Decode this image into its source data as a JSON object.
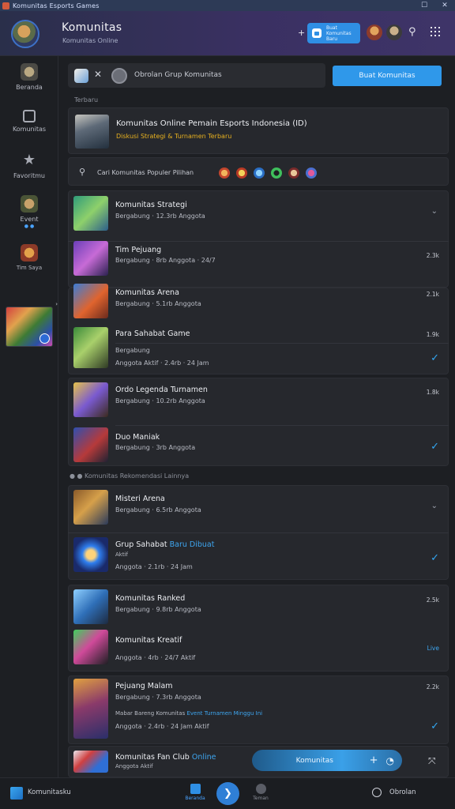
{
  "titlebar": {
    "title": "Komunitas Esports Games",
    "restore": "☐",
    "close": "✕"
  },
  "header": {
    "title": "Komunitas",
    "subtitle": "Komunitas Online",
    "plus": "+",
    "cta_label": "Buat Komunitas Baru",
    "search_icon": "⚲",
    "colors": {
      "accent": "#2f8fe4",
      "bg_start": "#2a2f4a",
      "bg_end": "#3e3468"
    }
  },
  "sidebar": {
    "items": [
      {
        "label": "Beranda"
      },
      {
        "label": "Komunitas"
      },
      {
        "label": "Favoritmu"
      },
      {
        "label": "Event",
        "sub": "● ●"
      },
      {
        "label": "Tim Saya"
      }
    ],
    "thumb_tag": "›"
  },
  "topbar": {
    "close_glyph": "✕",
    "text": "Obrolan Grup Komunitas",
    "primary_button": "Buat Komunitas"
  },
  "section_1": {
    "label": "Terbaru"
  },
  "feature": {
    "title": "Komunitas Online Pemain Esports Indonesia (ID)",
    "subtitle": "Diskusi Strategi & Turnamen Terbaru"
  },
  "filter": {
    "search_glyph": "⚲",
    "text": "Cari  Komunitas Populer  Pilihan"
  },
  "rows": [
    {
      "title": "Komunitas Strategi",
      "sub": "Bergabung · 12.3rb Anggota",
      "meta": "",
      "trailing": "chevron"
    },
    {
      "title": "Tim Pejuang",
      "sub": "Bergabung · 8rb Anggota · 24/7",
      "meta": "2.3k",
      "trailing": "none"
    },
    {
      "title": "Komunitas Arena",
      "sub": "Bergabung · 5.1rb Anggota",
      "meta": "2.1k",
      "trailing": "none"
    },
    {
      "title": "Para Sahabat Game",
      "sub": "",
      "meta": "1.9k",
      "trailing": "none"
    },
    {
      "title": "",
      "sub": "Anggota Aktif · 2.4rb · 24 Jam",
      "meta": "",
      "sub_top": "Bergabung",
      "trailing": "check"
    },
    {
      "title": "Ordo Legenda Turnamen",
      "sub": "Bergabung · 10.2rb Anggota",
      "meta": "1.8k",
      "trailing": "none"
    },
    {
      "title": "Duo Maniak",
      "sub": "Bergabung · 3rb Anggota",
      "meta": "",
      "trailing": "check"
    }
  ],
  "section_2": {
    "label": "● ● Komunitas Rekomendasi Lainnya"
  },
  "rows2": [
    {
      "title": "Misteri Arena",
      "sub": "Bergabung · 6.5rb Anggota",
      "meta": "",
      "trailing": "chevron"
    },
    {
      "title": "Grup Sahabat",
      "accent": "Baru Dibuat",
      "sub": "Aktif",
      "sub2": "Anggota · 2.1rb · 24 Jam",
      "meta": "",
      "trailing": "check"
    },
    {
      "title": "Komunitas Ranked",
      "sub": "Bergabung · 9.8rb Anggota",
      "meta": "2.5k",
      "trailing": "none"
    },
    {
      "title": "Komunitas Kreatif",
      "sub": "Anggota · 4rb · 24/7 Aktif",
      "meta": "Live",
      "trailing": "none"
    },
    {
      "title": "Pejuang Malam",
      "sub": "Bergabung · 7.3rb Anggota",
      "meta": "2.2k",
      "trailing": "none"
    },
    {
      "title": "",
      "sub_top": "Mabar Bareng Komunitas",
      "accent": "Event Turnamen Minggu Ini",
      "sub": "Anggota · 2.4rb · 24 Jam Aktif",
      "meta": "",
      "trailing": "check"
    },
    {
      "title": "Komunitas Fan Club",
      "accent": "Online",
      "sub": "Anggota Aktif",
      "meta": "",
      "trailing": "none"
    }
  ],
  "floating_bar": {
    "label": "Komunitas",
    "plus": "+",
    "ring": "◔",
    "side": "⤧"
  },
  "bottombar": {
    "app_name": "Komunitasku",
    "tab1": "Beranda",
    "fab": "❯",
    "tab2": "Teman",
    "right_label": "Obrolan"
  }
}
